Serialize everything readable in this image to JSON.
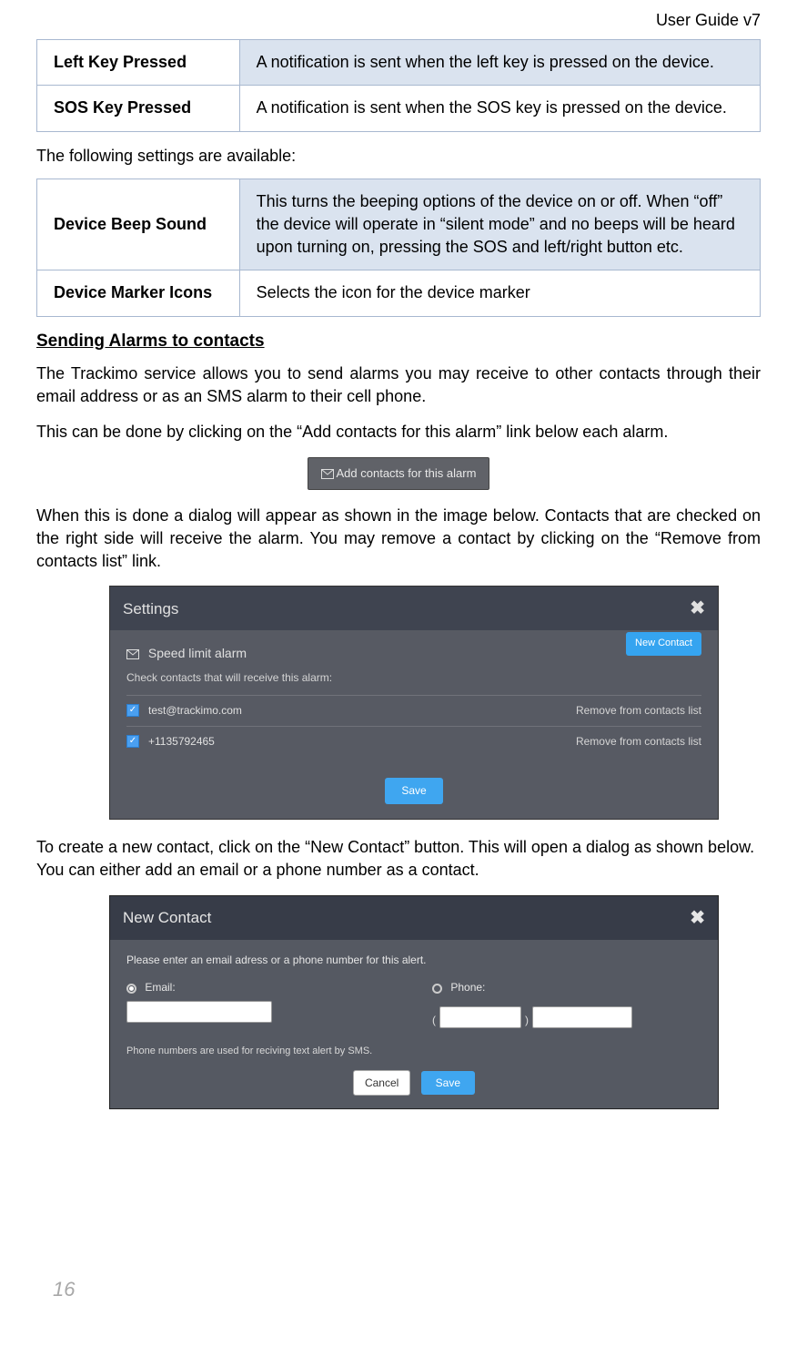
{
  "header": {
    "title": "User Guide v7"
  },
  "table1": {
    "rows": [
      {
        "label": "Left Key Pressed",
        "desc": "A notification is sent when the left key is pressed on the device."
      },
      {
        "label": "SOS Key Pressed",
        "desc": "A notification is sent when the SOS key is pressed on the device."
      }
    ]
  },
  "table2_intro": "The following settings are available:",
  "table2": {
    "rows": [
      {
        "label": "Device Beep Sound",
        "desc": "This turns the beeping options of the device on or off. When “off” the device will operate in “silent mode” and no beeps will be heard upon turning on, pressing the SOS and left/right button etc."
      },
      {
        "label": "Device Marker Icons",
        "desc": "Selects the icon for the device marker"
      }
    ]
  },
  "section": {
    "heading": "Sending Alarms to contacts",
    "para1": "The Trackimo service allows you to send alarms you may receive to other contacts through their email address or as an SMS alarm to their cell phone.",
    "para2": "This can be done by clicking on the “Add contacts for this alarm” link below each alarm.",
    "para3": "When this is done a dialog will appear as shown in the image below.  Contacts that are checked on the right side will receive the alarm.  You may remove a contact by clicking on the “Remove from contacts list” link.",
    "para4": "To create a new contact, click on the “New Contact” button. This will open a dialog as shown below.  You can either add an email or a phone number as a contact."
  },
  "fig1": {
    "label": "Add contacts for this alarm"
  },
  "fig2": {
    "title": "Settings",
    "subtitle": "Speed limit alarm",
    "instruction": "Check contacts that will receive this alarm:",
    "new_contact_btn": "New Contact",
    "contacts": [
      {
        "value": "test@trackimo.com",
        "remove": "Remove from contacts list"
      },
      {
        "value": "+1135792465",
        "remove": "Remove from contacts list"
      }
    ],
    "save_btn": "Save"
  },
  "fig3": {
    "title": "New Contact",
    "instruction": "Please enter an email adress or a phone number for this alert.",
    "email_label": "Email:",
    "phone_label": "Phone:",
    "note": "Phone numbers are used for reciving text alert by SMS.",
    "cancel_btn": "Cancel",
    "save_btn": "Save"
  },
  "page_number": "16"
}
